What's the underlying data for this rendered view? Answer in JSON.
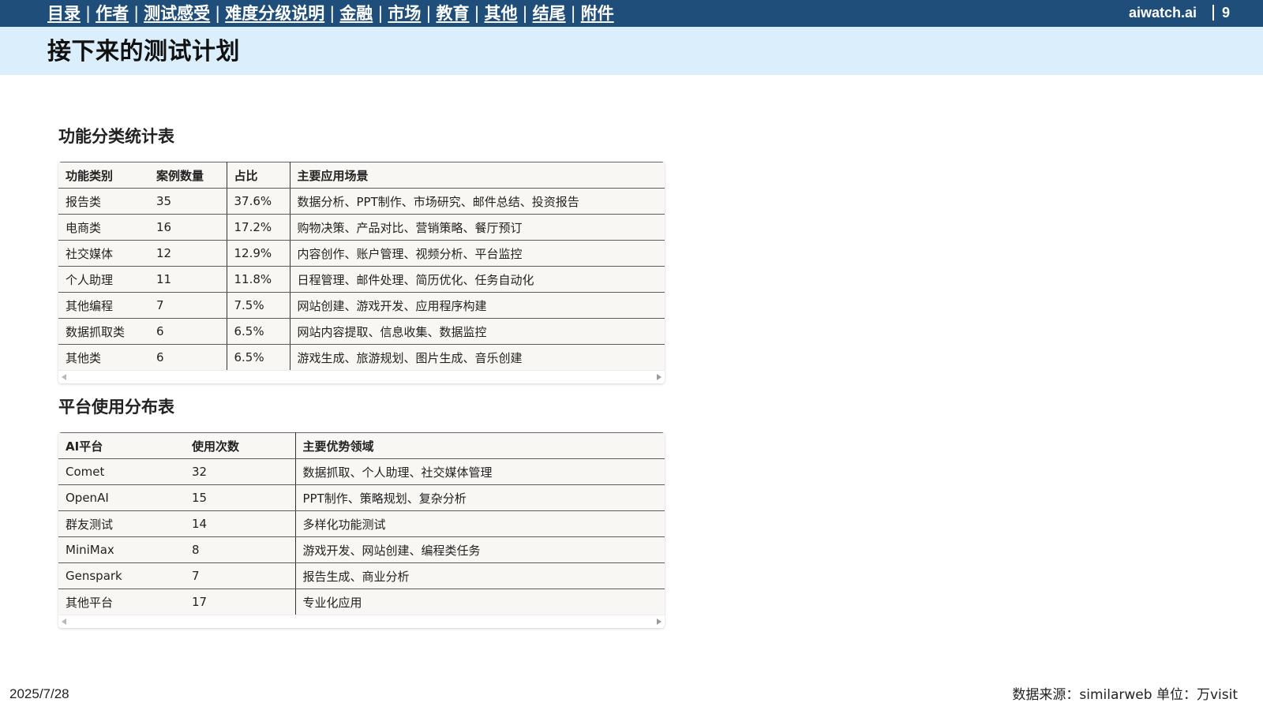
{
  "nav": {
    "items": [
      {
        "label": "目录"
      },
      {
        "label": "作者"
      },
      {
        "label": "测试感受"
      },
      {
        "label": "难度分级说明"
      },
      {
        "label": "金融"
      },
      {
        "label": "市场"
      },
      {
        "label": "教育"
      },
      {
        "label": "其他"
      },
      {
        "label": "结尾"
      },
      {
        "label": "附件"
      }
    ],
    "separator": "|",
    "brand": "aiwatch.ai",
    "page_number": "9",
    "bg_color": "#1f4e7b"
  },
  "title_band": {
    "title": "接下来的测试计划",
    "bg_color": "#dbeefc"
  },
  "table1": {
    "heading": "功能分类统计表",
    "headers": [
      "功能类别",
      "案例数量",
      "占比",
      "主要应用场景"
    ],
    "rows": [
      [
        "报告类",
        "35",
        "37.6%",
        "数据分析、PPT制作、市场研究、邮件总结、投资报告"
      ],
      [
        "电商类",
        "16",
        "17.2%",
        "购物决策、产品对比、营销策略、餐厅预订"
      ],
      [
        "社交媒体",
        "12",
        "12.9%",
        "内容创作、账户管理、视频分析、平台监控"
      ],
      [
        "个人助理",
        "11",
        "11.8%",
        "日程管理、邮件处理、简历优化、任务自动化"
      ],
      [
        "其他编程",
        "7",
        "7.5%",
        "网站创建、游戏开发、应用程序构建"
      ],
      [
        "数据抓取类",
        "6",
        "6.5%",
        "网站内容提取、信息收集、数据监控"
      ],
      [
        "其他类",
        "6",
        "6.5%",
        "游戏生成、旅游规划、图片生成、音乐创建"
      ]
    ]
  },
  "table2": {
    "heading": "平台使用分布表",
    "headers": [
      "AI平台",
      "使用次数",
      "主要优势领域"
    ],
    "rows": [
      [
        "Comet",
        "32",
        "数据抓取、个人助理、社交媒体管理"
      ],
      [
        "OpenAI",
        "15",
        "PPT制作、策略规划、复杂分析"
      ],
      [
        "群友测试",
        "14",
        "多样化功能测试"
      ],
      [
        "MiniMax",
        "8",
        "游戏开发、网站创建、编程类任务"
      ],
      [
        "Genspark",
        "7",
        "报告生成、商业分析"
      ],
      [
        "其他平台",
        "17",
        "专业化应用"
      ]
    ]
  },
  "footer": {
    "date": "2025/7/28",
    "source": "数据来源：similarweb  单位：万visit"
  }
}
